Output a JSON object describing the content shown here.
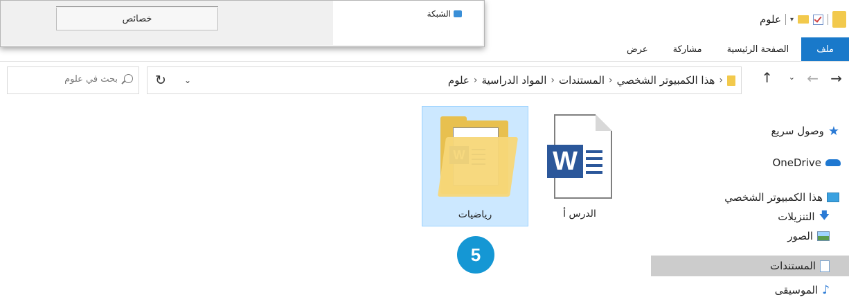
{
  "window": {
    "title": "علوم"
  },
  "ribbon": {
    "tabs": [
      {
        "label": "ملف",
        "active": true
      },
      {
        "label": "الصفحة الرئيسية"
      },
      {
        "label": "مشاركة"
      },
      {
        "label": "عرض"
      }
    ]
  },
  "address": {
    "path": [
      "هذا الكمبيوتر الشخصي",
      "المستندات",
      "المواد الدراسية",
      "علوم"
    ]
  },
  "search": {
    "placeholder": "بحث في علوم"
  },
  "nav": {
    "items": [
      {
        "label": "وصول سريع",
        "icon": "star-icon"
      },
      {
        "label": "OneDrive",
        "icon": "cloud-icon"
      },
      {
        "label": "هذا الكمبيوتر الشخصي",
        "icon": "computer-icon"
      },
      {
        "label": "التنزيلات",
        "icon": "download-icon"
      },
      {
        "label": "الصور",
        "icon": "pictures-icon"
      },
      {
        "label": "المستندات",
        "icon": "documents-icon",
        "selected": true
      },
      {
        "label": "الموسيقى",
        "icon": "music-icon"
      }
    ]
  },
  "files": [
    {
      "name": "الدرس أ",
      "type": "word-document"
    },
    {
      "name": "رياضيات",
      "type": "folder",
      "selected": true
    }
  ],
  "step_badge": "5",
  "overlay": {
    "properties_label": "خصائص",
    "network_label": "الشبكة"
  },
  "colors": {
    "file_tab": "#1979ca",
    "selection": "#cce8ff",
    "nav_selected": "#cccccc",
    "badge": "#1597d4",
    "word_blue": "#2b579a"
  }
}
